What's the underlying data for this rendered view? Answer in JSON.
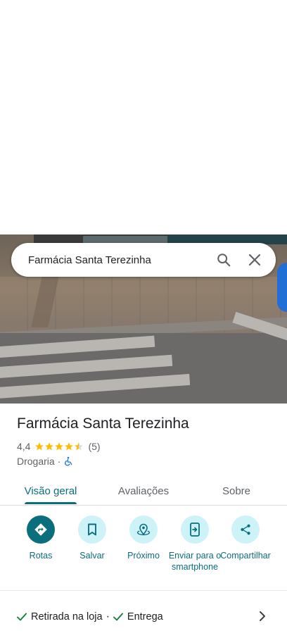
{
  "search": {
    "query": "Farmácia Santa Terezinha"
  },
  "place": {
    "name": "Farmácia Santa Terezinha",
    "rating": "4,4",
    "rating_value": 4.4,
    "review_count": "(5)",
    "category": "Drogaria",
    "separator": "·"
  },
  "tabs": [
    {
      "label": "Visão geral",
      "active": true
    },
    {
      "label": "Avaliações",
      "active": false
    },
    {
      "label": "Sobre",
      "active": false
    }
  ],
  "actions": [
    {
      "label": "Rotas",
      "icon": "directions-icon"
    },
    {
      "label": "Salvar",
      "icon": "bookmark-icon"
    },
    {
      "label": "Próximo",
      "icon": "nearby-icon"
    },
    {
      "label": "Enviar para o smartphone",
      "icon": "send-to-phone-icon"
    },
    {
      "label": "Compartilhar",
      "icon": "share-icon"
    }
  ],
  "services": {
    "items": [
      "Retirada na loja",
      "Entrega"
    ],
    "separator": "·"
  },
  "colors": {
    "accent": "#0b6e7d",
    "chip_bg": "#cdf2f8",
    "star": "#fbbc04",
    "check": "#188038"
  }
}
